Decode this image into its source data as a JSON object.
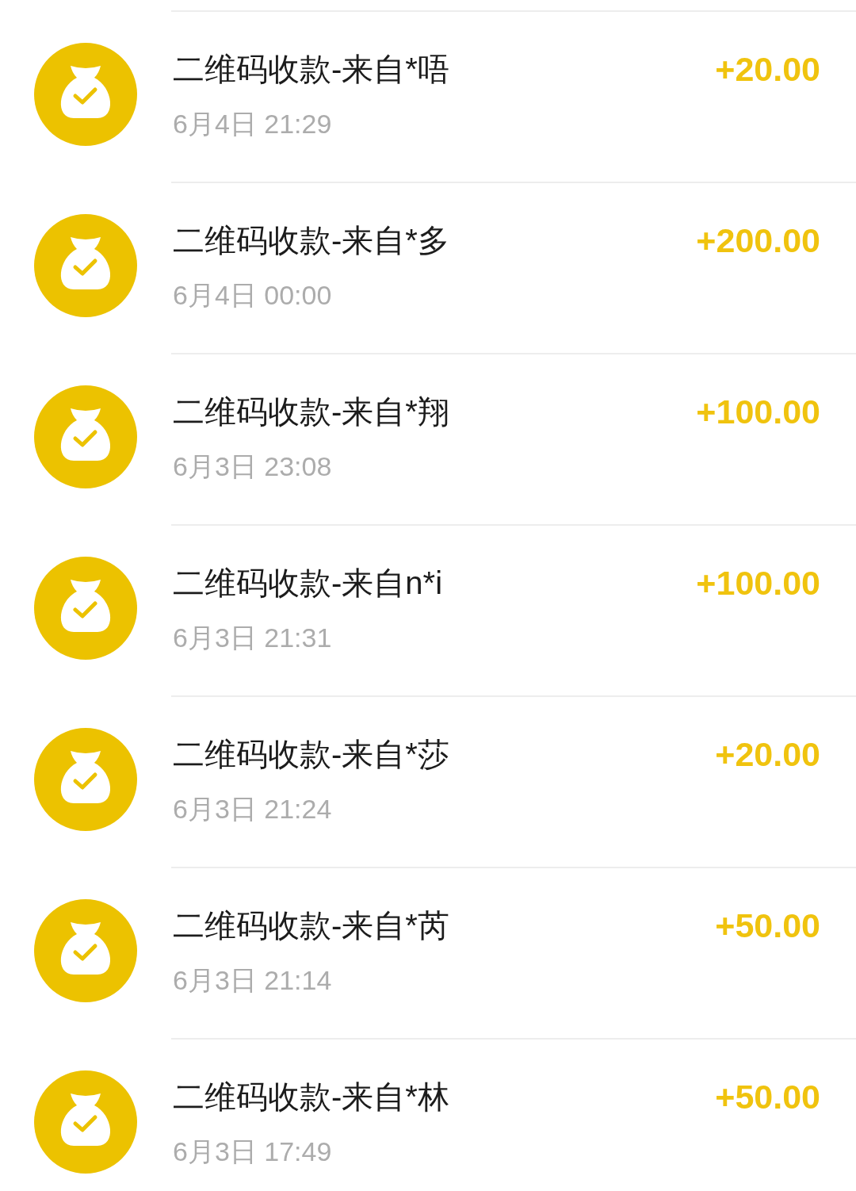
{
  "transactions": [
    {
      "title": "二维码收款-来自*唔",
      "time": "6月4日 21:29",
      "amount": "+20.00"
    },
    {
      "title": "二维码收款-来自*多",
      "time": "6月4日 00:00",
      "amount": "+200.00"
    },
    {
      "title": "二维码收款-来自*翔",
      "time": "6月3日 23:08",
      "amount": "+100.00"
    },
    {
      "title": "二维码收款-来自n*i",
      "time": "6月3日 21:31",
      "amount": "+100.00"
    },
    {
      "title": "二维码收款-来自*莎",
      "time": "6月3日 21:24",
      "amount": "+20.00"
    },
    {
      "title": "二维码收款-来自*芮",
      "time": "6月3日 21:14",
      "amount": "+50.00"
    },
    {
      "title": "二维码收款-来自*林",
      "time": "6月3日 17:49",
      "amount": "+50.00"
    }
  ]
}
